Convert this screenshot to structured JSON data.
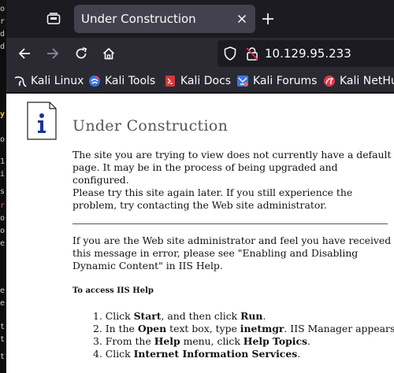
{
  "tab": {
    "title": "Under Construction"
  },
  "navbar": {
    "url": "10.129.95.233"
  },
  "bookmarks": [
    {
      "label": "Kali Linux",
      "icon": "kali-dragon-icon"
    },
    {
      "label": "Kali Tools",
      "icon": "kali-tools-icon"
    },
    {
      "label": "Kali Docs",
      "icon": "kali-docs-icon"
    },
    {
      "label": "Kali Forums",
      "icon": "kali-forums-icon"
    },
    {
      "label": "Kali NetHu",
      "icon": "kali-nethunter-icon"
    }
  ],
  "page": {
    "heading": "Under Construction",
    "para1": "The site you are trying to view does not currently have a default page. It may be in the process of being upgraded and configured.",
    "para2": "Please try this site again later. If you still experience the problem, try contacting the Web site administrator.",
    "para3": "If you are the Web site administrator and feel you have received this message in error, please see \"Enabling and Disabling Dynamic Content\" in IIS Help.",
    "access_title": "To access IIS Help",
    "steps": [
      {
        "num": "1.",
        "parts": [
          {
            "t": "Click "
          },
          {
            "t": "Start",
            "b": true
          },
          {
            "t": ", and then click "
          },
          {
            "t": "Run",
            "b": true
          },
          {
            "t": "."
          }
        ]
      },
      {
        "num": "2.",
        "parts": [
          {
            "t": "In the "
          },
          {
            "t": "Open",
            "b": true
          },
          {
            "t": " text box, type "
          },
          {
            "t": "inetmgr",
            "b": true
          },
          {
            "t": ". IIS Manager appears."
          }
        ]
      },
      {
        "num": "3.",
        "parts": [
          {
            "t": "From the "
          },
          {
            "t": "Help",
            "b": true
          },
          {
            "t": " menu, click "
          },
          {
            "t": "Help Topics",
            "b": true
          },
          {
            "t": "."
          }
        ]
      },
      {
        "num": "4.",
        "parts": [
          {
            "t": "Click "
          },
          {
            "t": "Internet Information Services",
            "b": true
          },
          {
            "t": "."
          }
        ]
      }
    ]
  },
  "left_strip_glyphs": [
    "o",
    "r",
    "d",
    "d",
    "y",
    "o",
    "1",
    "i",
    "s",
    "r",
    "o",
    "o",
    "e",
    "e",
    "e",
    "t",
    "t",
    "t"
  ],
  "colors": {
    "tabbar_bg": "#1c1b22",
    "navbar_bg": "#2b2a33",
    "active_tab": "#42414d",
    "page_bg": "#ffffff"
  }
}
